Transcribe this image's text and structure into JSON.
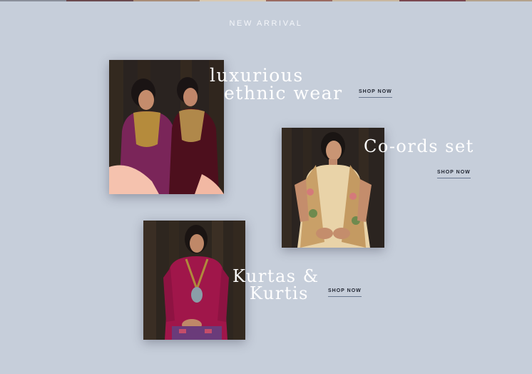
{
  "section": {
    "title": "NEW ARRIVAL"
  },
  "cards": [
    {
      "line1": "luxurious",
      "line2": "ethnic wear",
      "cta": "SHOP NOW",
      "image_alt": "two women in embroidered purple and maroon kurtas"
    },
    {
      "line1": "Co-ords set",
      "line2": "",
      "cta": "SHOP NOW",
      "image_alt": "woman in floral printed co-ord set"
    },
    {
      "line1": "Kurtas &",
      "line2": "Kurtis",
      "cta": "SHOP NOW",
      "image_alt": "woman in magenta kurta with pendant necklace"
    }
  ],
  "colors": {
    "background": "#c6ceda",
    "text_light": "#ffffff",
    "cta_text": "#1f2430"
  }
}
